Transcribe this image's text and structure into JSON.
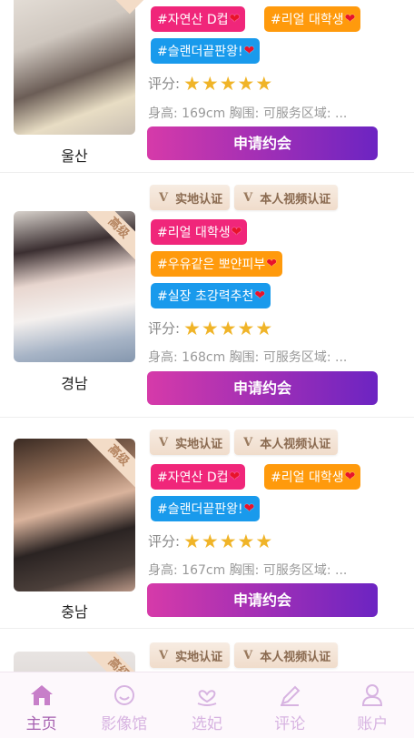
{
  "colors": {
    "tag_pink": "#f0267a",
    "tag_orange": "#ff9a0c",
    "tag_blue": "#199aec",
    "button_start": "#d63aa9",
    "button_end": "#6c24c2",
    "star": "#f0b428",
    "tab_active": "#a660b0",
    "tab_inactive": "#d7b3e1"
  },
  "cards": [
    {
      "badge": "",
      "region": "울산",
      "certs": [],
      "tags": [
        {
          "text": "#자연산 D컵",
          "color": "pink"
        },
        {
          "text": "#리얼 대학생",
          "color": "orange"
        },
        {
          "text": "#슬랜더끝판왕!",
          "color": "blue"
        }
      ],
      "rating_label": "评分:",
      "stars": 5,
      "info": "身高: 169cm 胸围: 可服务区域: ...",
      "apply_label": "申请约会"
    },
    {
      "badge": "高级",
      "region": "경남",
      "certs": [
        {
          "icon": "V",
          "label": "实地认证"
        },
        {
          "icon": "V",
          "label": "本人视频认证"
        }
      ],
      "tags": [
        {
          "text": "#리얼 대학생",
          "color": "pink"
        },
        {
          "text": "#우유같은 뽀얀피부",
          "color": "orange"
        },
        {
          "text": "#실장 초강력추천",
          "color": "blue"
        }
      ],
      "rating_label": "评分:",
      "stars": 5,
      "info": "身高: 168cm 胸围: 可服务区域: ...",
      "apply_label": "申请约会"
    },
    {
      "badge": "高级",
      "region": "충남",
      "certs": [
        {
          "icon": "V",
          "label": "实地认证"
        },
        {
          "icon": "V",
          "label": "本人视频认证"
        }
      ],
      "tags": [
        {
          "text": "#자연산 D컵",
          "color": "pink"
        },
        {
          "text": "#리얼 대학생",
          "color": "orange"
        },
        {
          "text": "#슬랜더끝판왕!",
          "color": "blue"
        }
      ],
      "rating_label": "评分:",
      "stars": 5,
      "info": "身高: 167cm 胸围: 可服务区域: ...",
      "apply_label": "申请约会"
    },
    {
      "badge": "高级",
      "region": "",
      "certs": [
        {
          "icon": "V",
          "label": "实地认证"
        },
        {
          "icon": "V",
          "label": "本人视频认证"
        }
      ],
      "tags": [],
      "rating_label": "",
      "stars": 0,
      "info": "",
      "apply_label": ""
    }
  ],
  "tabbar": [
    {
      "label": "主页",
      "icon": "home-icon",
      "active": true
    },
    {
      "label": "影像馆",
      "icon": "smiley-icon",
      "active": false
    },
    {
      "label": "选妃",
      "icon": "heart-hand-icon",
      "active": false
    },
    {
      "label": "评论",
      "icon": "pencil-icon",
      "active": false
    },
    {
      "label": "账户",
      "icon": "user-icon",
      "active": false
    }
  ]
}
